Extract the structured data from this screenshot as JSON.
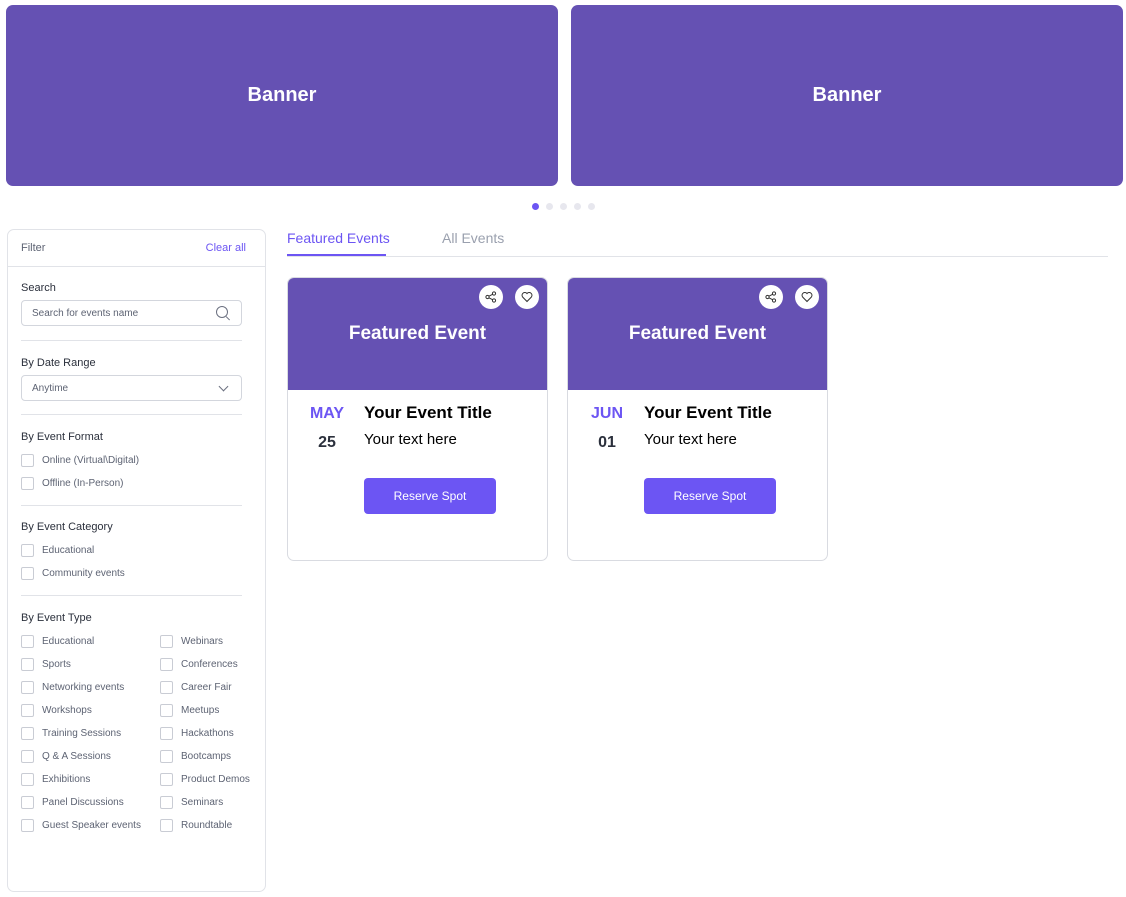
{
  "banners": [
    {
      "label": "Banner"
    },
    {
      "label": "Banner"
    }
  ],
  "carousel": {
    "count": 5,
    "active": 1
  },
  "filter": {
    "title": "Filter",
    "clear_label": "Clear all",
    "search": {
      "label": "Search",
      "placeholder": "Search for events name"
    },
    "date_range": {
      "label": "By Date Range",
      "value": "Anytime"
    },
    "format": {
      "label": "By Event Format",
      "options": [
        "Online (Virtual\\Digital)",
        "Offline (In-Person)"
      ]
    },
    "category": {
      "label": "By Event Category",
      "options": [
        "Educational",
        "Community events"
      ]
    },
    "type": {
      "label": "By Event Type",
      "col1": [
        "Educational",
        "Sports",
        "Networking events",
        "Workshops",
        "Training Sessions",
        "Q & A Sessions",
        "Exhibitions",
        "Panel Discussions",
        "Guest Speaker events"
      ],
      "col2": [
        "Webinars",
        "Conferences",
        "Career Fair",
        "Meetups",
        "Hackathons",
        "Bootcamps",
        "Product Demos",
        "Seminars",
        "Roundtable"
      ]
    }
  },
  "tabs": [
    {
      "label": "Featured Events"
    },
    {
      "label": "All Events"
    }
  ],
  "cards": [
    {
      "image_label": "Featured Event",
      "month": "MAY",
      "day": "25",
      "title": "Your Event Title",
      "text": "Your text here",
      "button": "Reserve Spot"
    },
    {
      "image_label": "Featured Event",
      "month": "JUN",
      "day": "01",
      "title": "Your Event Title",
      "text": "Your text here",
      "button": "Reserve Spot"
    }
  ],
  "colors": {
    "accent": "#6c55f3",
    "banner": "#6551b3"
  },
  "icons": {
    "share": "share-icon",
    "heart": "heart-icon",
    "search": "search-icon",
    "chevron": "chevron-down-icon"
  }
}
